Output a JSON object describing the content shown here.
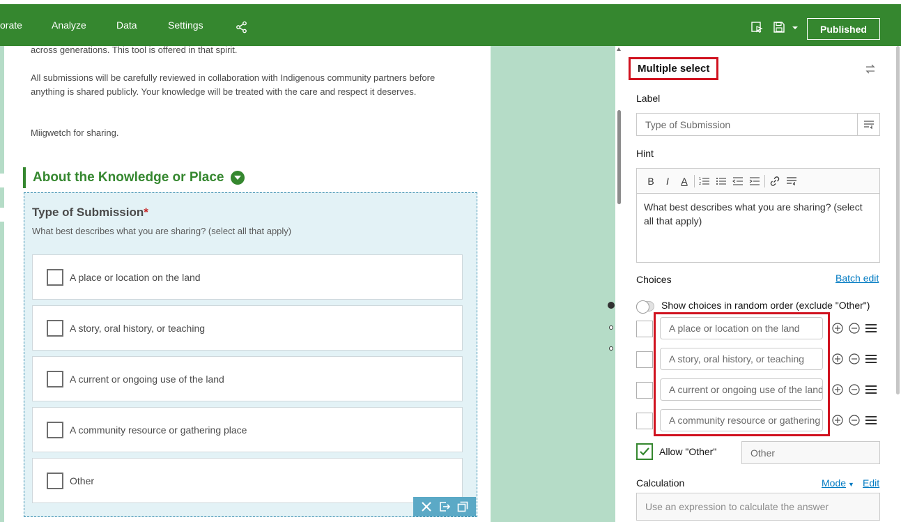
{
  "topbar": {
    "nav": [
      "orate",
      "Analyze",
      "Data",
      "Settings"
    ],
    "publish_label": "Published",
    "icons": [
      "share-icon",
      "preview-icon",
      "save-icon",
      "caret-down-icon"
    ]
  },
  "form": {
    "intro_lines": [
      "across generations. This tool is offered in that spirit.",
      "All submissions will be carefully reviewed in collaboration with Indigenous community partners before anything is shared publicly. Your knowledge will be treated with the care and respect it deserves.",
      "Miigwetch for sharing."
    ],
    "section_title": "About the Knowledge or Place",
    "question": {
      "title": "Type of Submission",
      "required_mark": "*",
      "hint": "What best describes what you are sharing? (select all that apply)",
      "choices": [
        "A place or location on the land",
        "A story, oral history, or teaching",
        "A current or ongoing use of the land",
        "A community resource or gathering place",
        "Other"
      ]
    }
  },
  "panel": {
    "title": "Multiple select",
    "label_heading": "Label",
    "label_value": "Type of Submission",
    "hint_heading": "Hint",
    "hint_toolbar": [
      "B",
      "I",
      "A"
    ],
    "hint_value": "What best describes what you are sharing? (select all that apply)",
    "choices_heading": "Choices",
    "batch_edit": "Batch edit",
    "random_order_label": "Show choices in random order (exclude \"Other\")",
    "choice_inputs": [
      "A place or location on the land",
      "A story, oral history, or teaching",
      "A current or ongoing use of the land",
      "A community resource or gathering place"
    ],
    "allow_other_label": "Allow \"Other\"",
    "other_value": "Other",
    "calculation_heading": "Calculation",
    "mode_link": "Mode",
    "edit_link": "Edit",
    "calculation_placeholder": "Use an expression to calculate the answer"
  },
  "colors": {
    "brand_green": "#35872f",
    "mint": "#b5dcc7",
    "highlight_red": "#d0121f",
    "question_bg": "#e3f2f6",
    "link_blue": "#007ac2"
  }
}
